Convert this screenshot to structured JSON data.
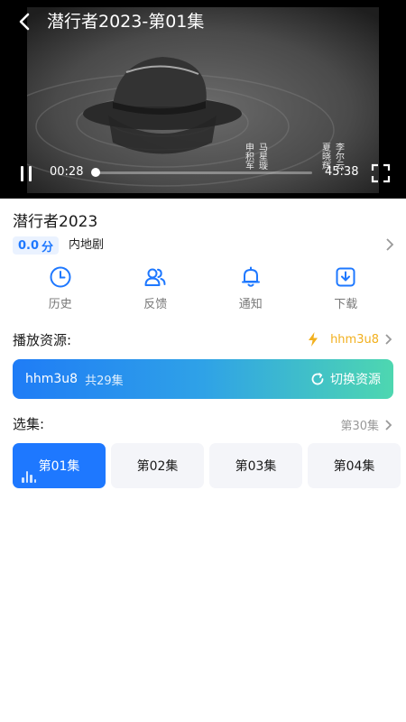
{
  "player": {
    "title": "潜行者2023-第01集",
    "current_time": "00:28",
    "total_time": "45:38",
    "progress": 0.01,
    "credits": [
      "李尔云",
      "夏晓辉",
      "马星璇",
      "申积军"
    ]
  },
  "show": {
    "title": "潜行者2023",
    "rating": "0.0",
    "rating_unit": "分",
    "genre": "内地剧"
  },
  "actions": [
    {
      "label": "历史",
      "icon": "clock-icon"
    },
    {
      "label": "反馈",
      "icon": "users-icon"
    },
    {
      "label": "通知",
      "icon": "bell-icon"
    },
    {
      "label": "下载",
      "icon": "download-icon"
    }
  ],
  "source": {
    "heading": "播放资源:",
    "selected": "hhm3u8",
    "current_name": "hhm3u8",
    "episode_count": "共29集",
    "switch_label": "切换资源"
  },
  "episodes": {
    "heading": "选集:",
    "latest": "第30集",
    "items": [
      "第01集",
      "第02集",
      "第03集",
      "第04集"
    ],
    "active_index": 0
  },
  "colors": {
    "accent": "#1e78ff",
    "source_gradient_start": "#1f7cf6",
    "source_gradient_end": "#4ed7b0",
    "source_badge": "#f2b01e"
  }
}
